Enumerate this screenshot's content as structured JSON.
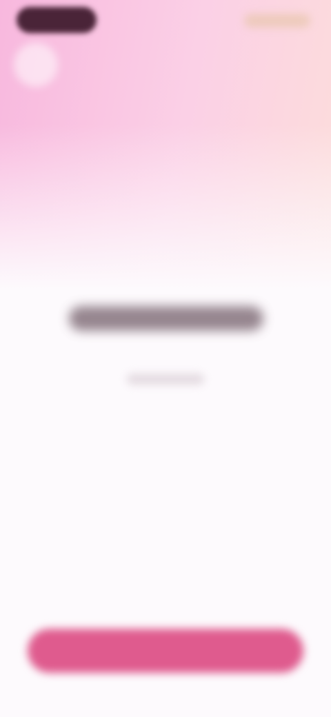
{
  "app": {
    "status_bar": {
      "left_pill": "",
      "right_indicators": ""
    },
    "header": {
      "icon_button": {
        "icon": "circle-icon",
        "label": ""
      }
    },
    "main": {
      "title": "",
      "subtitle": ""
    },
    "footer": {
      "primary_button_label": ""
    },
    "colors": {
      "gradient_start": "#f8b8de",
      "gradient_end": "#fde3d6",
      "background": "#fdfafd",
      "accent": "#df5b8e"
    }
  }
}
